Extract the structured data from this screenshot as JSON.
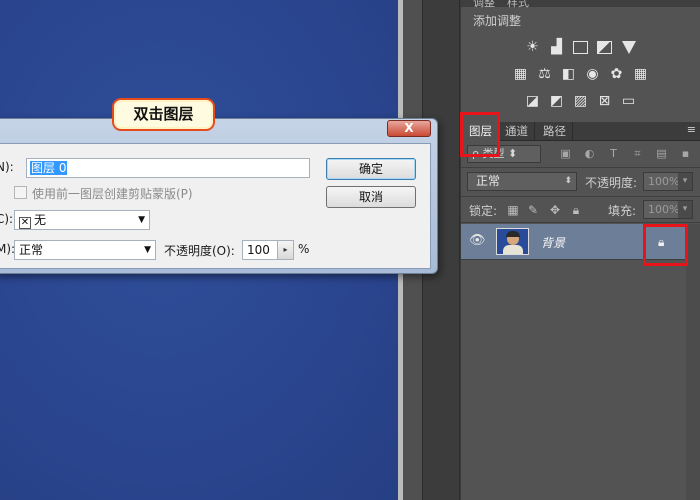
{
  "callout": {
    "text": "双击图层"
  },
  "dialog": {
    "close_label": "X",
    "name_label": "N):",
    "name_value": "图层 0",
    "clip_label": "使用前一图层创建剪贴蒙版(P)",
    "color_label": "C):",
    "color_value": "无",
    "mode_label": "M):",
    "mode_value": "正常",
    "opacity_label": "不透明度(O):",
    "opacity_value": "100",
    "opacity_unit": "%",
    "ok_label": "确定",
    "cancel_label": "取消"
  },
  "panel": {
    "top_tabs": [
      "调整",
      "样式"
    ],
    "adjust_title": "添加调整",
    "tabs": [
      "图层",
      "通道",
      "路径"
    ],
    "menu_icon": "≡",
    "filter_kind": "类型",
    "blend_mode": "正常",
    "opacity_label": "不透明度:",
    "opacity_value": "100%",
    "lock_label": "锁定:",
    "fill_label": "填充:",
    "fill_value": "100%",
    "layer_name": "背景"
  }
}
